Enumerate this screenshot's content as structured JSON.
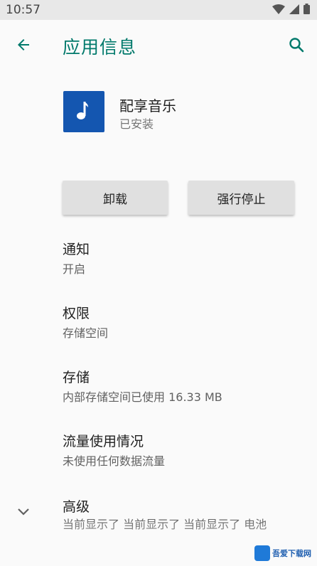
{
  "status_bar": {
    "time": "10:57",
    "icons": [
      "wifi-icon",
      "signal-icon",
      "battery-icon"
    ]
  },
  "app_bar": {
    "title": "应用信息",
    "back_icon": "arrow-left-icon",
    "search_icon": "search-icon",
    "accent": "#00796b"
  },
  "app": {
    "name": "配享音乐",
    "status": "已安装",
    "icon": "music-note-icon",
    "icon_color": "#1456b0"
  },
  "actions": {
    "uninstall_label": "卸载",
    "force_stop_label": "强行停止"
  },
  "settings": [
    {
      "title": "通知",
      "summary": "开启"
    },
    {
      "title": "权限",
      "summary": "存储空间"
    },
    {
      "title": "存储",
      "summary": "内部存储空间已使用 16.33 MB"
    },
    {
      "title": "流量使用情况",
      "summary": "未使用任何数据流量"
    }
  ],
  "advanced": {
    "title": "高级",
    "summary": "当前显示了 当前显示了 当前显示了 电池",
    "icon": "chevron-down-icon"
  },
  "watermark": {
    "text": "吾爱下载网"
  }
}
